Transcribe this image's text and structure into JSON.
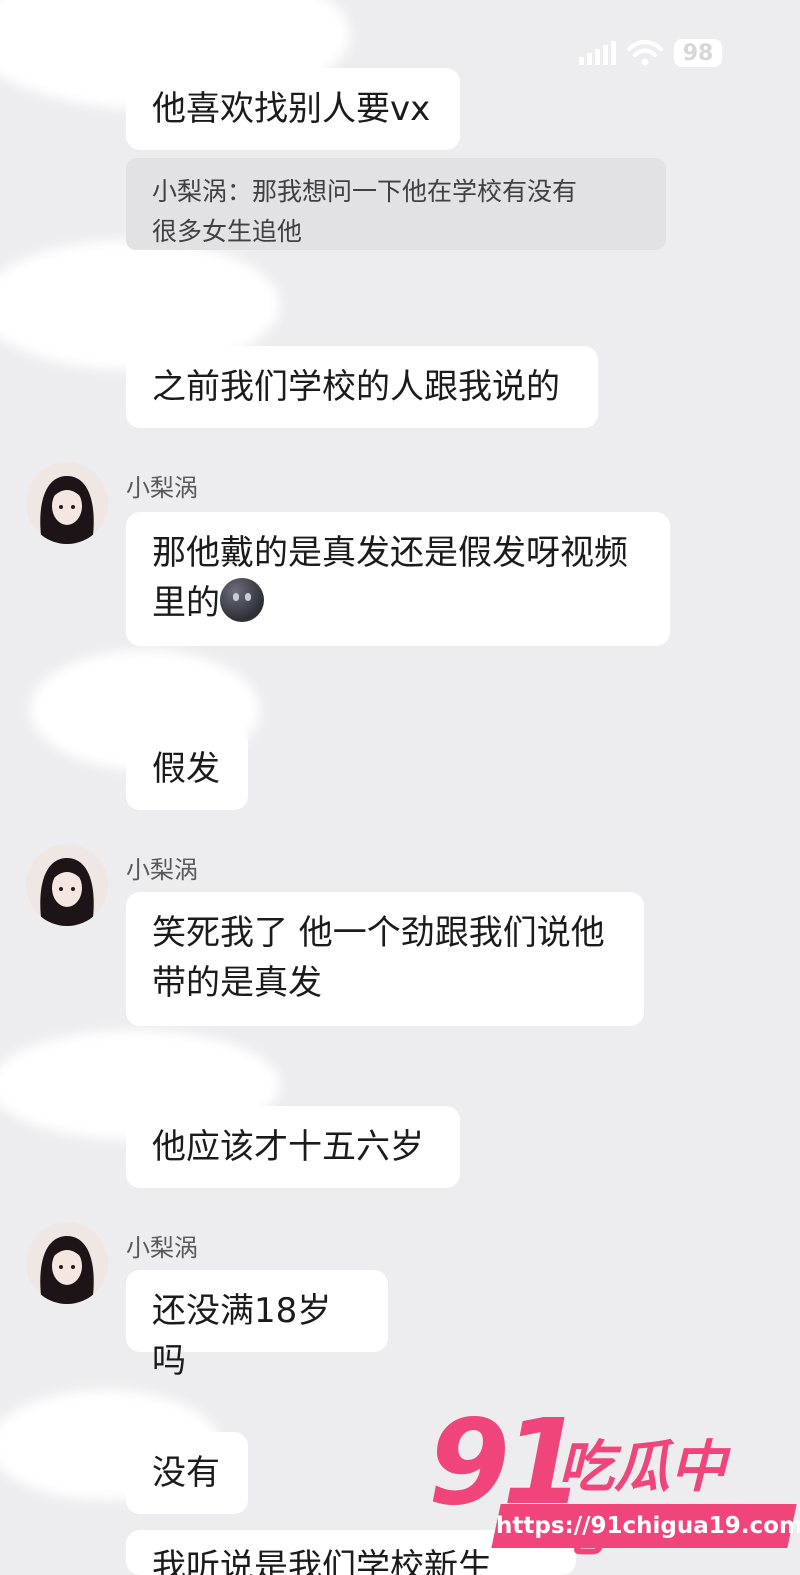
{
  "status_bar": {
    "battery": "98",
    "signal_icon": "cellular-signal-icon",
    "wifi_icon": "wifi-icon"
  },
  "quote": {
    "text": "小梨涡：那我想问一下他在学校有没有\n很多女生追他"
  },
  "messages": [
    {
      "text": "他喜欢找别人要vx"
    },
    {
      "text": "之前我们学校的人跟我说的"
    },
    {
      "sender": "小梨涡",
      "text": "那他戴的是真发还是假发呀视频\n里的",
      "emoji": "dark-face-emoji"
    },
    {
      "text": "假发"
    },
    {
      "sender": "小梨涡",
      "text": "笑死我了 他一个劲跟我们说他\n带的是真发"
    },
    {
      "text": "他应该才十五六岁"
    },
    {
      "sender": "小梨涡",
      "text": "还没满18岁吗"
    },
    {
      "text": "没有"
    },
    {
      "text": "我听说是我们学校新生"
    }
  ],
  "watermark": {
    "number": "91",
    "name": "吃瓜中心",
    "url": "https://91chigua19.com"
  },
  "colors": {
    "background": "#ededef",
    "bubble": "#ffffff",
    "watermark": "#f0457a"
  }
}
